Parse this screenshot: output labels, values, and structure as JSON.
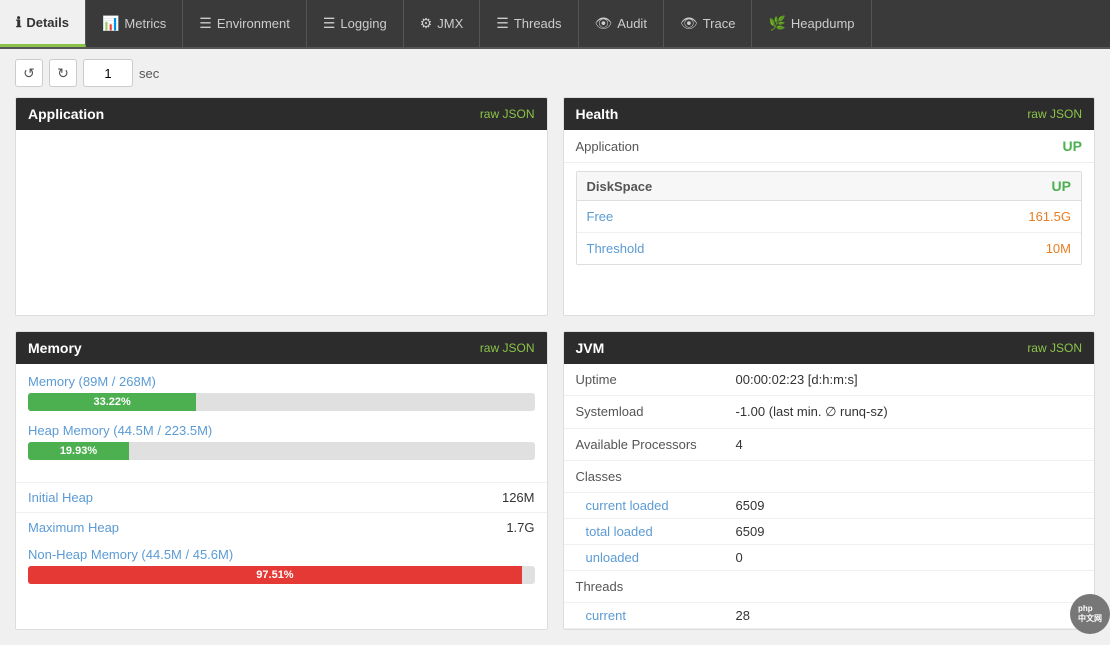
{
  "nav": {
    "tabs": [
      {
        "id": "details",
        "label": "Details",
        "icon": "ℹ",
        "active": true
      },
      {
        "id": "metrics",
        "label": "Metrics",
        "icon": "📊",
        "active": false
      },
      {
        "id": "environment",
        "label": "Environment",
        "icon": "☰",
        "active": false
      },
      {
        "id": "logging",
        "label": "Logging",
        "icon": "☰",
        "active": false
      },
      {
        "id": "jmx",
        "label": "JMX",
        "icon": "⚙",
        "active": false
      },
      {
        "id": "threads",
        "label": "Threads",
        "icon": "☰",
        "active": false
      },
      {
        "id": "audit",
        "label": "Audit",
        "icon": "👁",
        "active": false
      },
      {
        "id": "trace",
        "label": "Trace",
        "icon": "👁",
        "active": false
      },
      {
        "id": "heapdump",
        "label": "Heapdump",
        "icon": "🌿",
        "active": false
      }
    ]
  },
  "toolbar": {
    "refresh_icon": "↺",
    "auto_refresh_icon": "↻",
    "interval_value": "1",
    "interval_unit": "sec"
  },
  "application_card": {
    "title": "Application",
    "raw_json_label": "raw JSON"
  },
  "health_card": {
    "title": "Health",
    "raw_json_label": "raw JSON",
    "application_label": "Application",
    "application_status": "UP",
    "diskspace_label": "DiskSpace",
    "diskspace_status": "UP",
    "free_label": "Free",
    "free_value": "161.5G",
    "threshold_label": "Threshold",
    "threshold_value": "10M"
  },
  "memory_card": {
    "title": "Memory",
    "raw_json_label": "raw JSON",
    "memory_title": "Memory (89M / 268M)",
    "memory_percent": "33.22%",
    "memory_progress": 33.22,
    "heap_title": "Heap Memory (44.5M / 223.5M)",
    "heap_percent": "19.93%",
    "heap_progress": 19.93,
    "initial_heap_label": "Initial Heap",
    "initial_heap_value": "126M",
    "maximum_heap_label": "Maximum Heap",
    "maximum_heap_value": "1.7G",
    "non_heap_title": "Non-Heap Memory (44.5M / 45.6M)",
    "non_heap_percent": "97.51%",
    "non_heap_progress": 97.51
  },
  "jvm_card": {
    "title": "JVM",
    "raw_json_label": "raw JSON",
    "uptime_label": "Uptime",
    "uptime_value": "00:00:02:23 [d:h:m:s]",
    "systemload_label": "Systemload",
    "systemload_value": "-1.00 (last min. ∅ runq-sz)",
    "processors_label": "Available Processors",
    "processors_value": "4",
    "classes_label": "Classes",
    "classes_current_label": "current loaded",
    "classes_current_value": "6509",
    "classes_total_label": "total loaded",
    "classes_total_value": "6509",
    "classes_unloaded_label": "unloaded",
    "classes_unloaded_value": "0",
    "threads_label": "Threads",
    "threads_current_label": "current",
    "threads_current_value": "28"
  }
}
